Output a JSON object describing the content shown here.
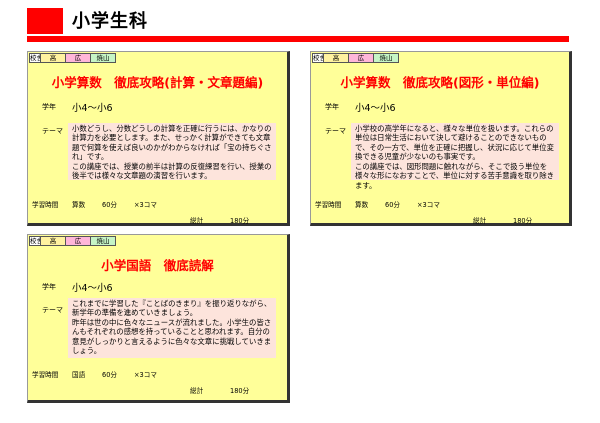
{
  "page": {
    "title": "小学生科"
  },
  "tags": {
    "label": "校舎",
    "t1": "高",
    "t2": "広",
    "t3": "焼山"
  },
  "labels": {
    "grade": "学年",
    "theme": "テーマ",
    "study_time": "学習時間",
    "total": "総計"
  },
  "colors": {
    "accent_red": "#ff0000",
    "card_bg": "#ffff99",
    "theme_bg": "#fde4dc"
  },
  "cards": [
    {
      "title": "小学算数　徹底攻略(計算・文章題編)",
      "grade": "小4～小6",
      "theme": "小数どうし、分数どうしの計算を正確に行うには、かなりの計算力を必要とします。また、せっかく計算ができても文章題で何算を使えば良いのかがわからなければ「宝の持ちぐされ」です。\nこの講座では、授業の前半は計算の反復練習を行い、授業の後半では様々な文章題の演習を行います。",
      "subject": "算数",
      "minutes": "60分",
      "sessions": "×3コマ",
      "total": "180分"
    },
    {
      "title": "小学算数　徹底攻略(図形・単位編)",
      "grade": "小4～小6",
      "theme": "小学校の高学年になると、様々な単位を扱います。これらの単位は日常生活において決して避けることのできないもので、その一方で、単位を正確に把握し、状況に応じて単位変換できる児童が少ないのも事実です。\nこの講座では、図形問題に触れながら、そこで扱う単位を様々な形になおすことで、単位に対する苦手意識を取り除きます。",
      "subject": "算数",
      "minutes": "60分",
      "sessions": "×3コマ",
      "total": "180分"
    },
    {
      "title": "小学国語　徹底読解",
      "grade": "小4～小6",
      "theme": "これまでに学習した『ことばのきまり』を振り返りながら、新学年の準備を進めていきましょう。\n昨年は世の中に色々なニュースが流れました。小学生の皆さんもそれぞれの感想を持っていることと思われます。自分の意見がしっかりと言えるように色々な文章に挑戦していきましょう。",
      "subject": "国語",
      "minutes": "60分",
      "sessions": "×3コマ",
      "total": "180分"
    }
  ]
}
